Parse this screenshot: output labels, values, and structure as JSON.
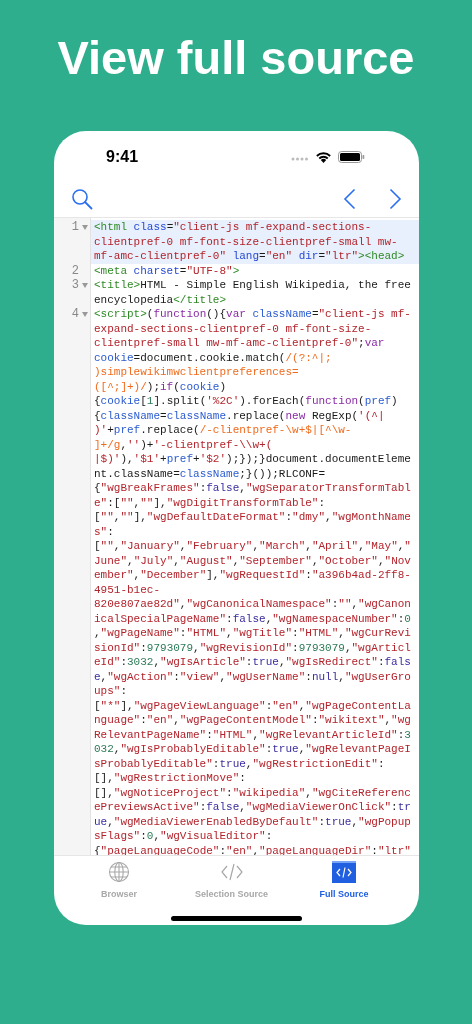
{
  "headline": "View full source",
  "status_bar": {
    "time": "9:41"
  },
  "code_lines": [
    {
      "number": "1",
      "fold": true,
      "selected": true,
      "visual_lines": [
        {
          "tokens": [
            {
              "kind": "tag",
              "text": "<html "
            },
            {
              "kind": "attr",
              "text": "class"
            },
            {
              "kind": "text",
              "text": "="
            },
            {
              "kind": "str",
              "text": "\"client-js mf-expand-sections-"
            }
          ]
        },
        {
          "tokens": [
            {
              "kind": "str",
              "text": "clientpref-0 mf-font-size-clientpref-small mw-"
            }
          ]
        },
        {
          "tokens": [
            {
              "kind": "str",
              "text": "mf-amc-clientpref-0\" "
            },
            {
              "kind": "attr",
              "text": "lang"
            },
            {
              "kind": "text",
              "text": "="
            },
            {
              "kind": "str",
              "text": "\"en\" "
            },
            {
              "kind": "attr",
              "text": "dir"
            },
            {
              "kind": "text",
              "text": "="
            },
            {
              "kind": "str",
              "text": "\"ltr\""
            },
            {
              "kind": "tag",
              "text": "><head>"
            }
          ]
        }
      ]
    },
    {
      "number": "2",
      "fold": false,
      "selected": false,
      "visual_lines": [
        {
          "tokens": [
            {
              "kind": "tag",
              "text": "<meta "
            },
            {
              "kind": "attr",
              "text": "charset"
            },
            {
              "kind": "text",
              "text": "="
            },
            {
              "kind": "str",
              "text": "\"UTF-8\""
            },
            {
              "kind": "tag",
              "text": ">"
            }
          ]
        }
      ]
    },
    {
      "number": "3",
      "fold": true,
      "selected": false,
      "visual_lines": [
        {
          "tokens": [
            {
              "kind": "tag",
              "text": "<title>"
            },
            {
              "kind": "text",
              "text": "HTML - Simple English Wikipedia, the free"
            }
          ]
        },
        {
          "tokens": [
            {
              "kind": "text",
              "text": "encyclopedia"
            },
            {
              "kind": "tag",
              "text": "</title>"
            }
          ]
        }
      ]
    },
    {
      "number": "4",
      "fold": true,
      "selected": false,
      "visual_lines": [
        {
          "tokens": [
            {
              "kind": "tag",
              "text": "<script>"
            },
            {
              "kind": "text",
              "text": "("
            },
            {
              "kind": "kw",
              "text": "function"
            },
            {
              "kind": "text",
              "text": "(){"
            },
            {
              "kind": "kw",
              "text": "var "
            },
            {
              "kind": "var",
              "text": "className"
            },
            {
              "kind": "text",
              "text": "="
            },
            {
              "kind": "str",
              "text": "\"client-js mf-"
            }
          ]
        },
        {
          "tokens": [
            {
              "kind": "str",
              "text": "expand-sections-clientpref-0 mf-font-size-"
            }
          ]
        },
        {
          "tokens": [
            {
              "kind": "str",
              "text": "clientpref-small mw-mf-amc-clientpref-0\""
            },
            {
              "kind": "text",
              "text": ";"
            },
            {
              "kind": "kw",
              "text": "var"
            }
          ]
        },
        {
          "tokens": [
            {
              "kind": "var",
              "text": "cookie"
            },
            {
              "kind": "text",
              "text": "=document.cookie.match("
            },
            {
              "kind": "re",
              "text": "/(?:^|;"
            }
          ]
        },
        {
          "tokens": [
            {
              "kind": "re",
              "text": ")simplewikimwclientpreferences="
            }
          ]
        },
        {
          "tokens": [
            {
              "kind": "re",
              "text": "([^;]+)/"
            },
            {
              "kind": "text",
              "text": ");"
            },
            {
              "kind": "kw",
              "text": "if"
            },
            {
              "kind": "text",
              "text": "("
            },
            {
              "kind": "var",
              "text": "cookie"
            },
            {
              "kind": "text",
              "text": ")"
            }
          ]
        },
        {
          "tokens": [
            {
              "kind": "text",
              "text": "{"
            },
            {
              "kind": "var",
              "text": "cookie"
            },
            {
              "kind": "text",
              "text": "["
            },
            {
              "kind": "num",
              "text": "1"
            },
            {
              "kind": "text",
              "text": "].split("
            },
            {
              "kind": "str",
              "text": "'%2C'"
            },
            {
              "kind": "text",
              "text": ").forEach("
            },
            {
              "kind": "kw",
              "text": "function"
            },
            {
              "kind": "text",
              "text": "("
            },
            {
              "kind": "var",
              "text": "pref"
            },
            {
              "kind": "text",
              "text": ")"
            }
          ]
        },
        {
          "tokens": [
            {
              "kind": "text",
              "text": "{"
            },
            {
              "kind": "var",
              "text": "className"
            },
            {
              "kind": "text",
              "text": "="
            },
            {
              "kind": "var",
              "text": "className"
            },
            {
              "kind": "text",
              "text": ".replace("
            },
            {
              "kind": "kw",
              "text": "new"
            },
            {
              "kind": "text",
              "text": " RegExp("
            },
            {
              "kind": "str",
              "text": "'(^|"
            }
          ]
        },
        {
          "tokens": [
            {
              "kind": "str",
              "text": ")'"
            },
            {
              "kind": "text",
              "text": "+"
            },
            {
              "kind": "var",
              "text": "pref"
            },
            {
              "kind": "text",
              "text": ".replace("
            },
            {
              "kind": "re",
              "text": "/-clientpref-\\w+$|[^\\w-"
            }
          ]
        },
        {
          "tokens": [
            {
              "kind": "re",
              "text": "]+/g"
            },
            {
              "kind": "text",
              "text": ","
            },
            {
              "kind": "str",
              "text": "''"
            },
            {
              "kind": "text",
              "text": ")+"
            },
            {
              "kind": "str",
              "text": "'-clientpref-\\\\w+("
            }
          ]
        },
        {
          "tokens": [
            {
              "kind": "str",
              "text": "|$)'"
            },
            {
              "kind": "text",
              "text": "),"
            },
            {
              "kind": "str",
              "text": "'$1'"
            },
            {
              "kind": "text",
              "text": "+"
            },
            {
              "kind": "var",
              "text": "pref"
            },
            {
              "kind": "text",
              "text": "+"
            },
            {
              "kind": "str",
              "text": "'$2'"
            },
            {
              "kind": "text",
              "text": ");});}document.documentEleme"
            }
          ]
        },
        {
          "tokens": [
            {
              "kind": "text",
              "text": "nt.className="
            },
            {
              "kind": "var",
              "text": "className"
            },
            {
              "kind": "text",
              "text": ";}());RLCONF="
            }
          ]
        },
        {
          "tokens": [
            {
              "kind": "text",
              "text": "{"
            },
            {
              "kind": "str",
              "text": "\"wgBreakFrames\""
            },
            {
              "kind": "text",
              "text": ":"
            },
            {
              "kind": "lit",
              "text": "false"
            },
            {
              "kind": "text",
              "text": ","
            },
            {
              "kind": "str",
              "text": "\"wgSeparatorTransformTabl"
            }
          ]
        },
        {
          "tokens": [
            {
              "kind": "str",
              "text": "e\""
            },
            {
              "kind": "text",
              "text": ":["
            },
            {
              "kind": "str",
              "text": "\"\""
            },
            {
              "kind": "text",
              "text": ","
            },
            {
              "kind": "str",
              "text": "\"\""
            },
            {
              "kind": "text",
              "text": "],"
            },
            {
              "kind": "str",
              "text": "\"wgDigitTransformTable\""
            },
            {
              "kind": "text",
              "text": ":"
            }
          ]
        },
        {
          "tokens": [
            {
              "kind": "text",
              "text": "["
            },
            {
              "kind": "str",
              "text": "\"\""
            },
            {
              "kind": "text",
              "text": ","
            },
            {
              "kind": "str",
              "text": "\"\""
            },
            {
              "kind": "text",
              "text": "],"
            },
            {
              "kind": "str",
              "text": "\"wgDefaultDateFormat\""
            },
            {
              "kind": "text",
              "text": ":"
            },
            {
              "kind": "str",
              "text": "\"dmy\""
            },
            {
              "kind": "text",
              "text": ","
            },
            {
              "kind": "str",
              "text": "\"wgMonthName"
            }
          ]
        },
        {
          "tokens": [
            {
              "kind": "str",
              "text": "s\""
            },
            {
              "kind": "text",
              "text": ":"
            }
          ]
        },
        {
          "tokens": [
            {
              "kind": "text",
              "text": "["
            },
            {
              "kind": "str",
              "text": "\"\""
            },
            {
              "kind": "text",
              "text": ","
            },
            {
              "kind": "str",
              "text": "\"January\""
            },
            {
              "kind": "text",
              "text": ","
            },
            {
              "kind": "str",
              "text": "\"February\""
            },
            {
              "kind": "text",
              "text": ","
            },
            {
              "kind": "str",
              "text": "\"March\""
            },
            {
              "kind": "text",
              "text": ","
            },
            {
              "kind": "str",
              "text": "\"April\""
            },
            {
              "kind": "text",
              "text": ","
            },
            {
              "kind": "str",
              "text": "\"May\""
            },
            {
              "kind": "text",
              "text": ","
            },
            {
              "kind": "str",
              "text": "\""
            }
          ]
        },
        {
          "tokens": [
            {
              "kind": "str",
              "text": "June\""
            },
            {
              "kind": "text",
              "text": ","
            },
            {
              "kind": "str",
              "text": "\"July\""
            },
            {
              "kind": "text",
              "text": ","
            },
            {
              "kind": "str",
              "text": "\"August\""
            },
            {
              "kind": "text",
              "text": ","
            },
            {
              "kind": "str",
              "text": "\"September\""
            },
            {
              "kind": "text",
              "text": ","
            },
            {
              "kind": "str",
              "text": "\"October\""
            },
            {
              "kind": "text",
              "text": ","
            },
            {
              "kind": "str",
              "text": "\"Nov"
            }
          ]
        },
        {
          "tokens": [
            {
              "kind": "str",
              "text": "ember\""
            },
            {
              "kind": "text",
              "text": ","
            },
            {
              "kind": "str",
              "text": "\"December\""
            },
            {
              "kind": "text",
              "text": "],"
            },
            {
              "kind": "str",
              "text": "\"wgRequestId\""
            },
            {
              "kind": "text",
              "text": ":"
            },
            {
              "kind": "str",
              "text": "\"a396b4ad-2ff8-"
            }
          ]
        },
        {
          "tokens": [
            {
              "kind": "str",
              "text": "4951-b1ec-"
            }
          ]
        },
        {
          "tokens": [
            {
              "kind": "str",
              "text": "820e807ae82d\""
            },
            {
              "kind": "text",
              "text": ","
            },
            {
              "kind": "str",
              "text": "\"wgCanonicalNamespace\""
            },
            {
              "kind": "text",
              "text": ":"
            },
            {
              "kind": "str",
              "text": "\"\""
            },
            {
              "kind": "text",
              "text": ","
            },
            {
              "kind": "str",
              "text": "\"wgCanon"
            }
          ]
        },
        {
          "tokens": [
            {
              "kind": "str",
              "text": "icalSpecialPageName\""
            },
            {
              "kind": "text",
              "text": ":"
            },
            {
              "kind": "lit",
              "text": "false"
            },
            {
              "kind": "text",
              "text": ","
            },
            {
              "kind": "str",
              "text": "\"wgNamespaceNumber\""
            },
            {
              "kind": "text",
              "text": ":"
            },
            {
              "kind": "num",
              "text": "0"
            }
          ]
        },
        {
          "tokens": [
            {
              "kind": "text",
              "text": ","
            },
            {
              "kind": "str",
              "text": "\"wgPageName\""
            },
            {
              "kind": "text",
              "text": ":"
            },
            {
              "kind": "str",
              "text": "\"HTML\""
            },
            {
              "kind": "text",
              "text": ","
            },
            {
              "kind": "str",
              "text": "\"wgTitle\""
            },
            {
              "kind": "text",
              "text": ":"
            },
            {
              "kind": "str",
              "text": "\"HTML\""
            },
            {
              "kind": "text",
              "text": ","
            },
            {
              "kind": "str",
              "text": "\"wgCurRevi"
            }
          ]
        },
        {
          "tokens": [
            {
              "kind": "str",
              "text": "sionId\""
            },
            {
              "kind": "text",
              "text": ":"
            },
            {
              "kind": "num",
              "text": "9793079"
            },
            {
              "kind": "text",
              "text": ","
            },
            {
              "kind": "str",
              "text": "\"wgRevisionId\""
            },
            {
              "kind": "text",
              "text": ":"
            },
            {
              "kind": "num",
              "text": "9793079"
            },
            {
              "kind": "text",
              "text": ","
            },
            {
              "kind": "str",
              "text": "\"wgArticl"
            }
          ]
        },
        {
          "tokens": [
            {
              "kind": "str",
              "text": "eId\""
            },
            {
              "kind": "text",
              "text": ":"
            },
            {
              "kind": "num",
              "text": "3032"
            },
            {
              "kind": "text",
              "text": ","
            },
            {
              "kind": "str",
              "text": "\"wgIsArticle\""
            },
            {
              "kind": "text",
              "text": ":"
            },
            {
              "kind": "lit",
              "text": "true"
            },
            {
              "kind": "text",
              "text": ","
            },
            {
              "kind": "str",
              "text": "\"wgIsRedirect\""
            },
            {
              "kind": "text",
              "text": ":"
            },
            {
              "kind": "lit",
              "text": "fals"
            }
          ]
        },
        {
          "tokens": [
            {
              "kind": "lit",
              "text": "e"
            },
            {
              "kind": "text",
              "text": ","
            },
            {
              "kind": "str",
              "text": "\"wgAction\""
            },
            {
              "kind": "text",
              "text": ":"
            },
            {
              "kind": "str",
              "text": "\"view\""
            },
            {
              "kind": "text",
              "text": ","
            },
            {
              "kind": "str",
              "text": "\"wgUserName\""
            },
            {
              "kind": "text",
              "text": ":"
            },
            {
              "kind": "lit",
              "text": "null"
            },
            {
              "kind": "text",
              "text": ","
            },
            {
              "kind": "str",
              "text": "\"wgUserGro"
            }
          ]
        },
        {
          "tokens": [
            {
              "kind": "str",
              "text": "ups\""
            },
            {
              "kind": "text",
              "text": ":"
            }
          ]
        },
        {
          "tokens": [
            {
              "kind": "text",
              "text": "["
            },
            {
              "kind": "str",
              "text": "\"*\""
            },
            {
              "kind": "text",
              "text": "],"
            },
            {
              "kind": "str",
              "text": "\"wgPageViewLanguage\""
            },
            {
              "kind": "text",
              "text": ":"
            },
            {
              "kind": "str",
              "text": "\"en\""
            },
            {
              "kind": "text",
              "text": ","
            },
            {
              "kind": "str",
              "text": "\"wgPageContentLa"
            }
          ]
        },
        {
          "tokens": [
            {
              "kind": "str",
              "text": "nguage\""
            },
            {
              "kind": "text",
              "text": ":"
            },
            {
              "kind": "str",
              "text": "\"en\""
            },
            {
              "kind": "text",
              "text": ","
            },
            {
              "kind": "str",
              "text": "\"wgPageContentModel\""
            },
            {
              "kind": "text",
              "text": ":"
            },
            {
              "kind": "str",
              "text": "\"wikitext\""
            },
            {
              "kind": "text",
              "text": ","
            },
            {
              "kind": "str",
              "text": "\"wg"
            }
          ]
        },
        {
          "tokens": [
            {
              "kind": "str",
              "text": "RelevantPageName\""
            },
            {
              "kind": "text",
              "text": ":"
            },
            {
              "kind": "str",
              "text": "\"HTML\""
            },
            {
              "kind": "text",
              "text": ","
            },
            {
              "kind": "str",
              "text": "\"wgRelevantArticleId\""
            },
            {
              "kind": "text",
              "text": ":"
            },
            {
              "kind": "num",
              "text": "3"
            }
          ]
        },
        {
          "tokens": [
            {
              "kind": "num",
              "text": "032"
            },
            {
              "kind": "text",
              "text": ","
            },
            {
              "kind": "str",
              "text": "\"wgIsProbablyEditable\""
            },
            {
              "kind": "text",
              "text": ":"
            },
            {
              "kind": "lit",
              "text": "true"
            },
            {
              "kind": "text",
              "text": ","
            },
            {
              "kind": "str",
              "text": "\"wgRelevantPageI"
            }
          ]
        },
        {
          "tokens": [
            {
              "kind": "str",
              "text": "sProbablyEditable\""
            },
            {
              "kind": "text",
              "text": ":"
            },
            {
              "kind": "lit",
              "text": "true"
            },
            {
              "kind": "text",
              "text": ","
            },
            {
              "kind": "str",
              "text": "\"wgRestrictionEdit\""
            },
            {
              "kind": "text",
              "text": ":"
            }
          ]
        },
        {
          "tokens": [
            {
              "kind": "text",
              "text": "[],"
            },
            {
              "kind": "str",
              "text": "\"wgRestrictionMove\""
            },
            {
              "kind": "text",
              "text": ":"
            }
          ]
        },
        {
          "tokens": [
            {
              "kind": "text",
              "text": "[],"
            },
            {
              "kind": "str",
              "text": "\"wgNoticeProject\""
            },
            {
              "kind": "text",
              "text": ":"
            },
            {
              "kind": "str",
              "text": "\"wikipedia\""
            },
            {
              "kind": "text",
              "text": ","
            },
            {
              "kind": "str",
              "text": "\"wgCiteReferenc"
            }
          ]
        },
        {
          "tokens": [
            {
              "kind": "str",
              "text": "ePreviewsActive\""
            },
            {
              "kind": "text",
              "text": ":"
            },
            {
              "kind": "lit",
              "text": "false"
            },
            {
              "kind": "text",
              "text": ","
            },
            {
              "kind": "str",
              "text": "\"wgMediaViewerOnClick\""
            },
            {
              "kind": "text",
              "text": ":"
            },
            {
              "kind": "lit",
              "text": "tr"
            }
          ]
        },
        {
          "tokens": [
            {
              "kind": "lit",
              "text": "ue"
            },
            {
              "kind": "text",
              "text": ","
            },
            {
              "kind": "str",
              "text": "\"wgMediaViewerEnabledByDefault\""
            },
            {
              "kind": "text",
              "text": ":"
            },
            {
              "kind": "lit",
              "text": "true"
            },
            {
              "kind": "text",
              "text": ","
            },
            {
              "kind": "str",
              "text": "\"wgPopup"
            }
          ]
        },
        {
          "tokens": [
            {
              "kind": "str",
              "text": "sFlags\""
            },
            {
              "kind": "text",
              "text": ":"
            },
            {
              "kind": "num",
              "text": "0"
            },
            {
              "kind": "text",
              "text": ","
            },
            {
              "kind": "str",
              "text": "\"wgVisualEditor\""
            },
            {
              "kind": "text",
              "text": ":"
            }
          ]
        },
        {
          "tokens": [
            {
              "kind": "text",
              "text": "{"
            },
            {
              "kind": "str",
              "text": "\"pageLanguageCode\""
            },
            {
              "kind": "text",
              "text": ":"
            },
            {
              "kind": "str",
              "text": "\"en\""
            },
            {
              "kind": "text",
              "text": ","
            },
            {
              "kind": "str",
              "text": "\"pageLanguageDir\""
            },
            {
              "kind": "text",
              "text": ":"
            },
            {
              "kind": "str",
              "text": "\"ltr\""
            }
          ]
        }
      ]
    }
  ],
  "tabs": [
    {
      "kind": "globe",
      "label": "Browser",
      "selected": false
    },
    {
      "kind": "code",
      "label": "Selection Source",
      "selected": false
    },
    {
      "kind": "code-box",
      "label": "Full Source",
      "selected": true
    }
  ]
}
